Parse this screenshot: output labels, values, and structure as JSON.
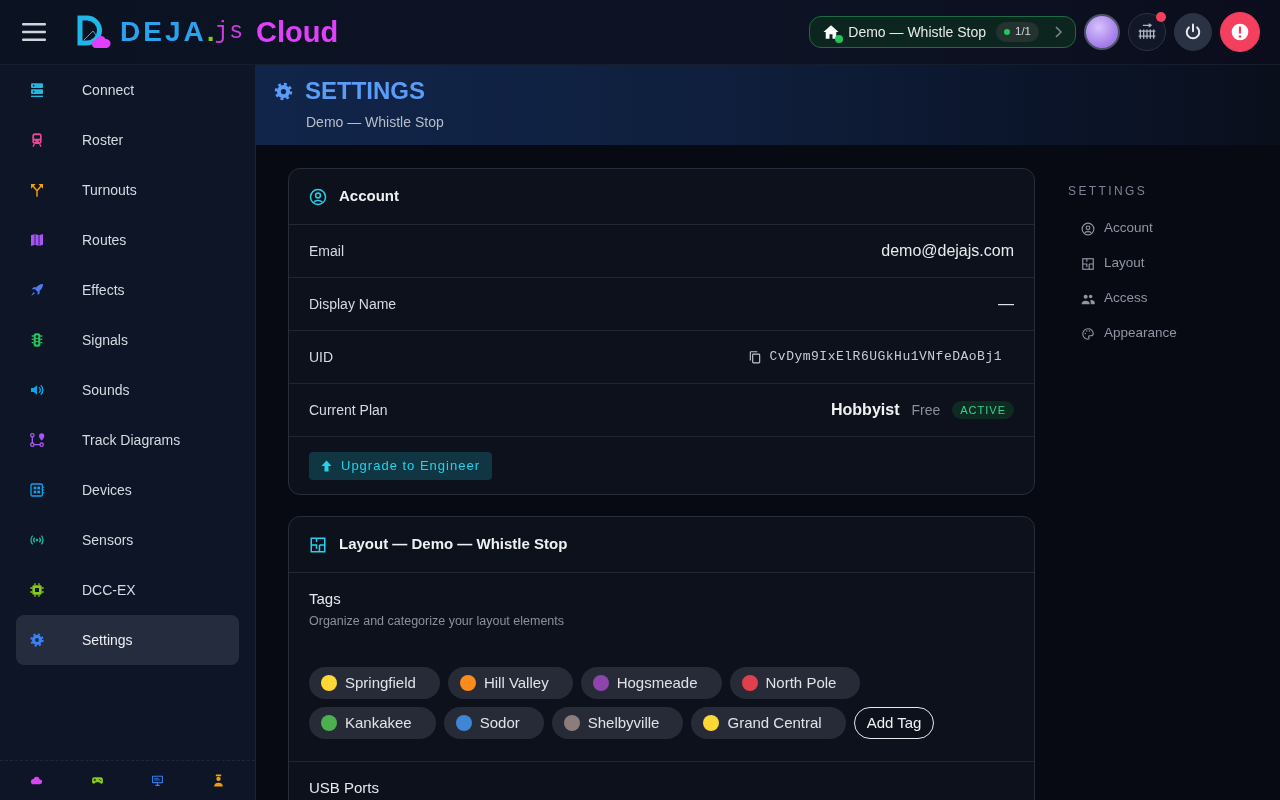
{
  "topbar": {
    "brand": {
      "name": "DEJA",
      "dot": ".",
      "extension": "js",
      "product": "Cloud"
    },
    "layout_selector": {
      "label": "Demo — Whistle Stop",
      "connected": true,
      "count": "1/1"
    },
    "notification": true
  },
  "sidebar": {
    "items": [
      {
        "label": "Connect",
        "selected": false
      },
      {
        "label": "Roster",
        "selected": false
      },
      {
        "label": "Turnouts",
        "selected": false
      },
      {
        "label": "Routes",
        "selected": false
      },
      {
        "label": "Effects",
        "selected": false
      },
      {
        "label": "Signals",
        "selected": false
      },
      {
        "label": "Sounds",
        "selected": false
      },
      {
        "label": "Track Diagrams",
        "selected": false
      },
      {
        "label": "Devices",
        "selected": false
      },
      {
        "label": "Sensors",
        "selected": false
      },
      {
        "label": "DCC-EX",
        "selected": false
      },
      {
        "label": "Settings",
        "selected": true
      }
    ]
  },
  "page_header": {
    "title": "SETTINGS",
    "subtitle": "Demo — Whistle Stop"
  },
  "account_card": {
    "title": "Account",
    "rows": [
      {
        "kind": "text",
        "label": "Email",
        "value": "demo@dejajs.com"
      },
      {
        "kind": "text",
        "label": "Display Name",
        "value": "—"
      },
      {
        "kind": "uid",
        "label": "UID",
        "value": "CvDym9IxElR6UGkHu1VNfeDAoBj1"
      },
      {
        "kind": "plan",
        "label": "Current Plan",
        "plan": "Hobbyist",
        "tier": "Free",
        "status": "ACTIVE"
      }
    ],
    "upgrade_button": "Upgrade to Engineer"
  },
  "layout_card": {
    "title": "Layout — Demo — Whistle Stop",
    "tags_section": {
      "title": "Tags",
      "description": "Organize and categorize your layout elements",
      "tags": [
        {
          "label": "Springfield",
          "color": "#fdd835"
        },
        {
          "label": "Hill Valley",
          "color": "#fb8c1c"
        },
        {
          "label": "Hogsmeade",
          "color": "#8e44ad"
        },
        {
          "label": "North Pole",
          "color": "#e0404c"
        },
        {
          "label": "Kankakee",
          "color": "#4caf50"
        },
        {
          "label": "Sodor",
          "color": "#3f86d6"
        },
        {
          "label": "Shelbyville",
          "color": "#8c7c7c"
        },
        {
          "label": "Grand Central",
          "color": "#fdd835"
        }
      ],
      "add_button": "Add Tag"
    },
    "usb_section": {
      "title": "USB Ports"
    }
  },
  "settings_nav": {
    "heading": "SETTINGS",
    "items": [
      {
        "label": "Account"
      },
      {
        "label": "Layout"
      },
      {
        "label": "Access"
      },
      {
        "label": "Appearance"
      }
    ]
  }
}
